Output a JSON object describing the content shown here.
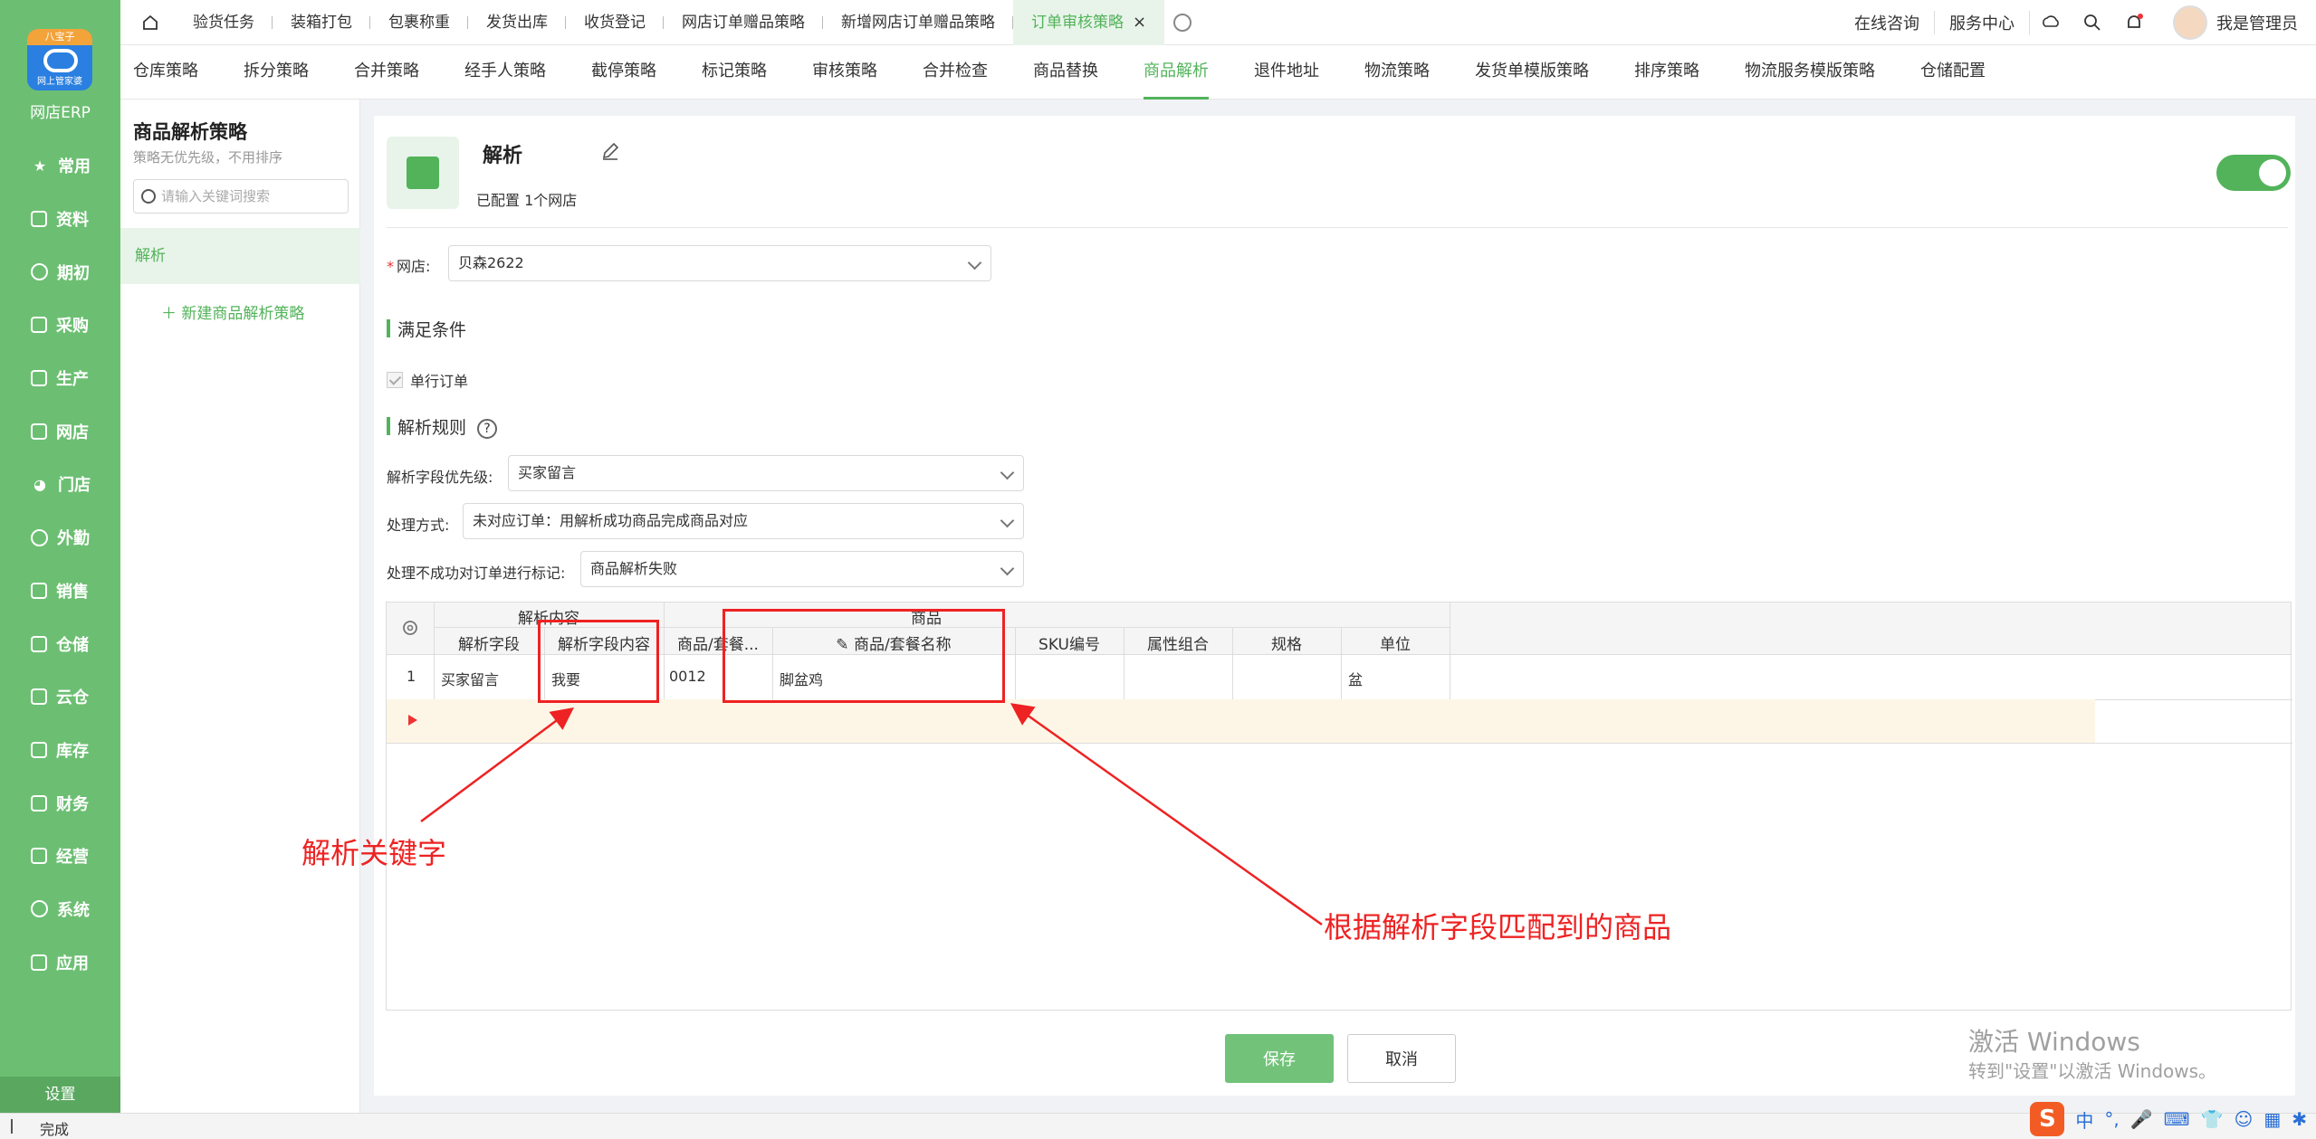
{
  "sidebar": {
    "logo_badge": "八宝子",
    "logo_label": "网上管家婆",
    "brand": "网店ERP",
    "items": [
      {
        "label": "常用",
        "icon": "star-icon"
      },
      {
        "label": "资料",
        "icon": "document-icon"
      },
      {
        "label": "期初",
        "icon": "target-icon"
      },
      {
        "label": "采购",
        "icon": "purchase-icon"
      },
      {
        "label": "生产",
        "icon": "production-icon"
      },
      {
        "label": "网店",
        "icon": "store-icon"
      },
      {
        "label": "门店",
        "icon": "pie-icon"
      },
      {
        "label": "外勤",
        "icon": "fieldwork-icon"
      },
      {
        "label": "销售",
        "icon": "sales-icon"
      },
      {
        "label": "仓储",
        "icon": "warehouse-icon"
      },
      {
        "label": "云仓",
        "icon": "cloud-warehouse-icon"
      },
      {
        "label": "库存",
        "icon": "inventory-icon"
      },
      {
        "label": "财务",
        "icon": "finance-icon"
      },
      {
        "label": "经营",
        "icon": "business-icon"
      },
      {
        "label": "系统",
        "icon": "system-icon"
      },
      {
        "label": "应用",
        "icon": "apps-icon"
      }
    ],
    "settings": "设置"
  },
  "topbar": {
    "tabs": [
      "验货任务",
      "装箱打包",
      "包裹称重",
      "发货出库",
      "收货登记",
      "网店订单赠品策略",
      "新增网店订单赠品策略"
    ],
    "active_tab": "订单审核策略",
    "links": [
      "在线咨询",
      "服务中心"
    ],
    "user": "我是管理员"
  },
  "strategies": {
    "items": [
      "仓库策略",
      "拆分策略",
      "合并策略",
      "经手人策略",
      "截停策略",
      "标记策略",
      "审核策略",
      "合并检查",
      "商品替换",
      "商品解析",
      "退件地址",
      "物流策略",
      "发货单模版策略",
      "排序策略",
      "物流服务模版策略",
      "仓储配置"
    ],
    "active": "商品解析"
  },
  "left_panel": {
    "title": "商品解析策略",
    "subtitle": "策略无优先级，不用排序",
    "search_placeholder": "请输入关键词搜索",
    "selected": "解析",
    "new_label": "新建商品解析策略"
  },
  "main": {
    "name": "解析",
    "configured": "已配置  1个网店",
    "enabled": true,
    "shop_label": "网店:",
    "shop_value": "贝森2622",
    "condition_title": "满足条件",
    "single_order": "单行订单",
    "rule_title": "解析规则",
    "priority_label": "解析字段优先级:",
    "priority_value": "买家留言",
    "method_label": "处理方式:",
    "method_value": "未对应订单：用解析成功商品完成商品对应",
    "fail_label": "处理不成功对订单进行标记:",
    "fail_value": "商品解析失败"
  },
  "grid": {
    "group_parse": "解析内容",
    "group_product": "商品",
    "columns": [
      "解析字段",
      "解析字段内容",
      "商品/套餐...",
      "商品/套餐名称",
      "SKU编号",
      "属性组合",
      "规格",
      "单位"
    ],
    "rows": [
      {
        "no": "1",
        "field": "买家留言",
        "content": "我要",
        "code": "0012",
        "name": "脚盆鸡",
        "sku": "",
        "attr": "",
        "spec": "",
        "unit": "盆"
      }
    ]
  },
  "buttons": {
    "save": "保存",
    "cancel": "取消"
  },
  "annotations": {
    "keyword": "解析关键字",
    "matched": "根据解析字段匹配到的商品"
  },
  "watermark": {
    "line1": "激活 Windows",
    "line2": "转到\"设置\"以激活 Windows。"
  },
  "status": {
    "text": "完成"
  },
  "tray": {
    "logo": "S",
    "ime": "中"
  },
  "colors": {
    "accent": "#52b35a",
    "sidebar": "#6cbf72",
    "annotation": "#ee2222"
  }
}
